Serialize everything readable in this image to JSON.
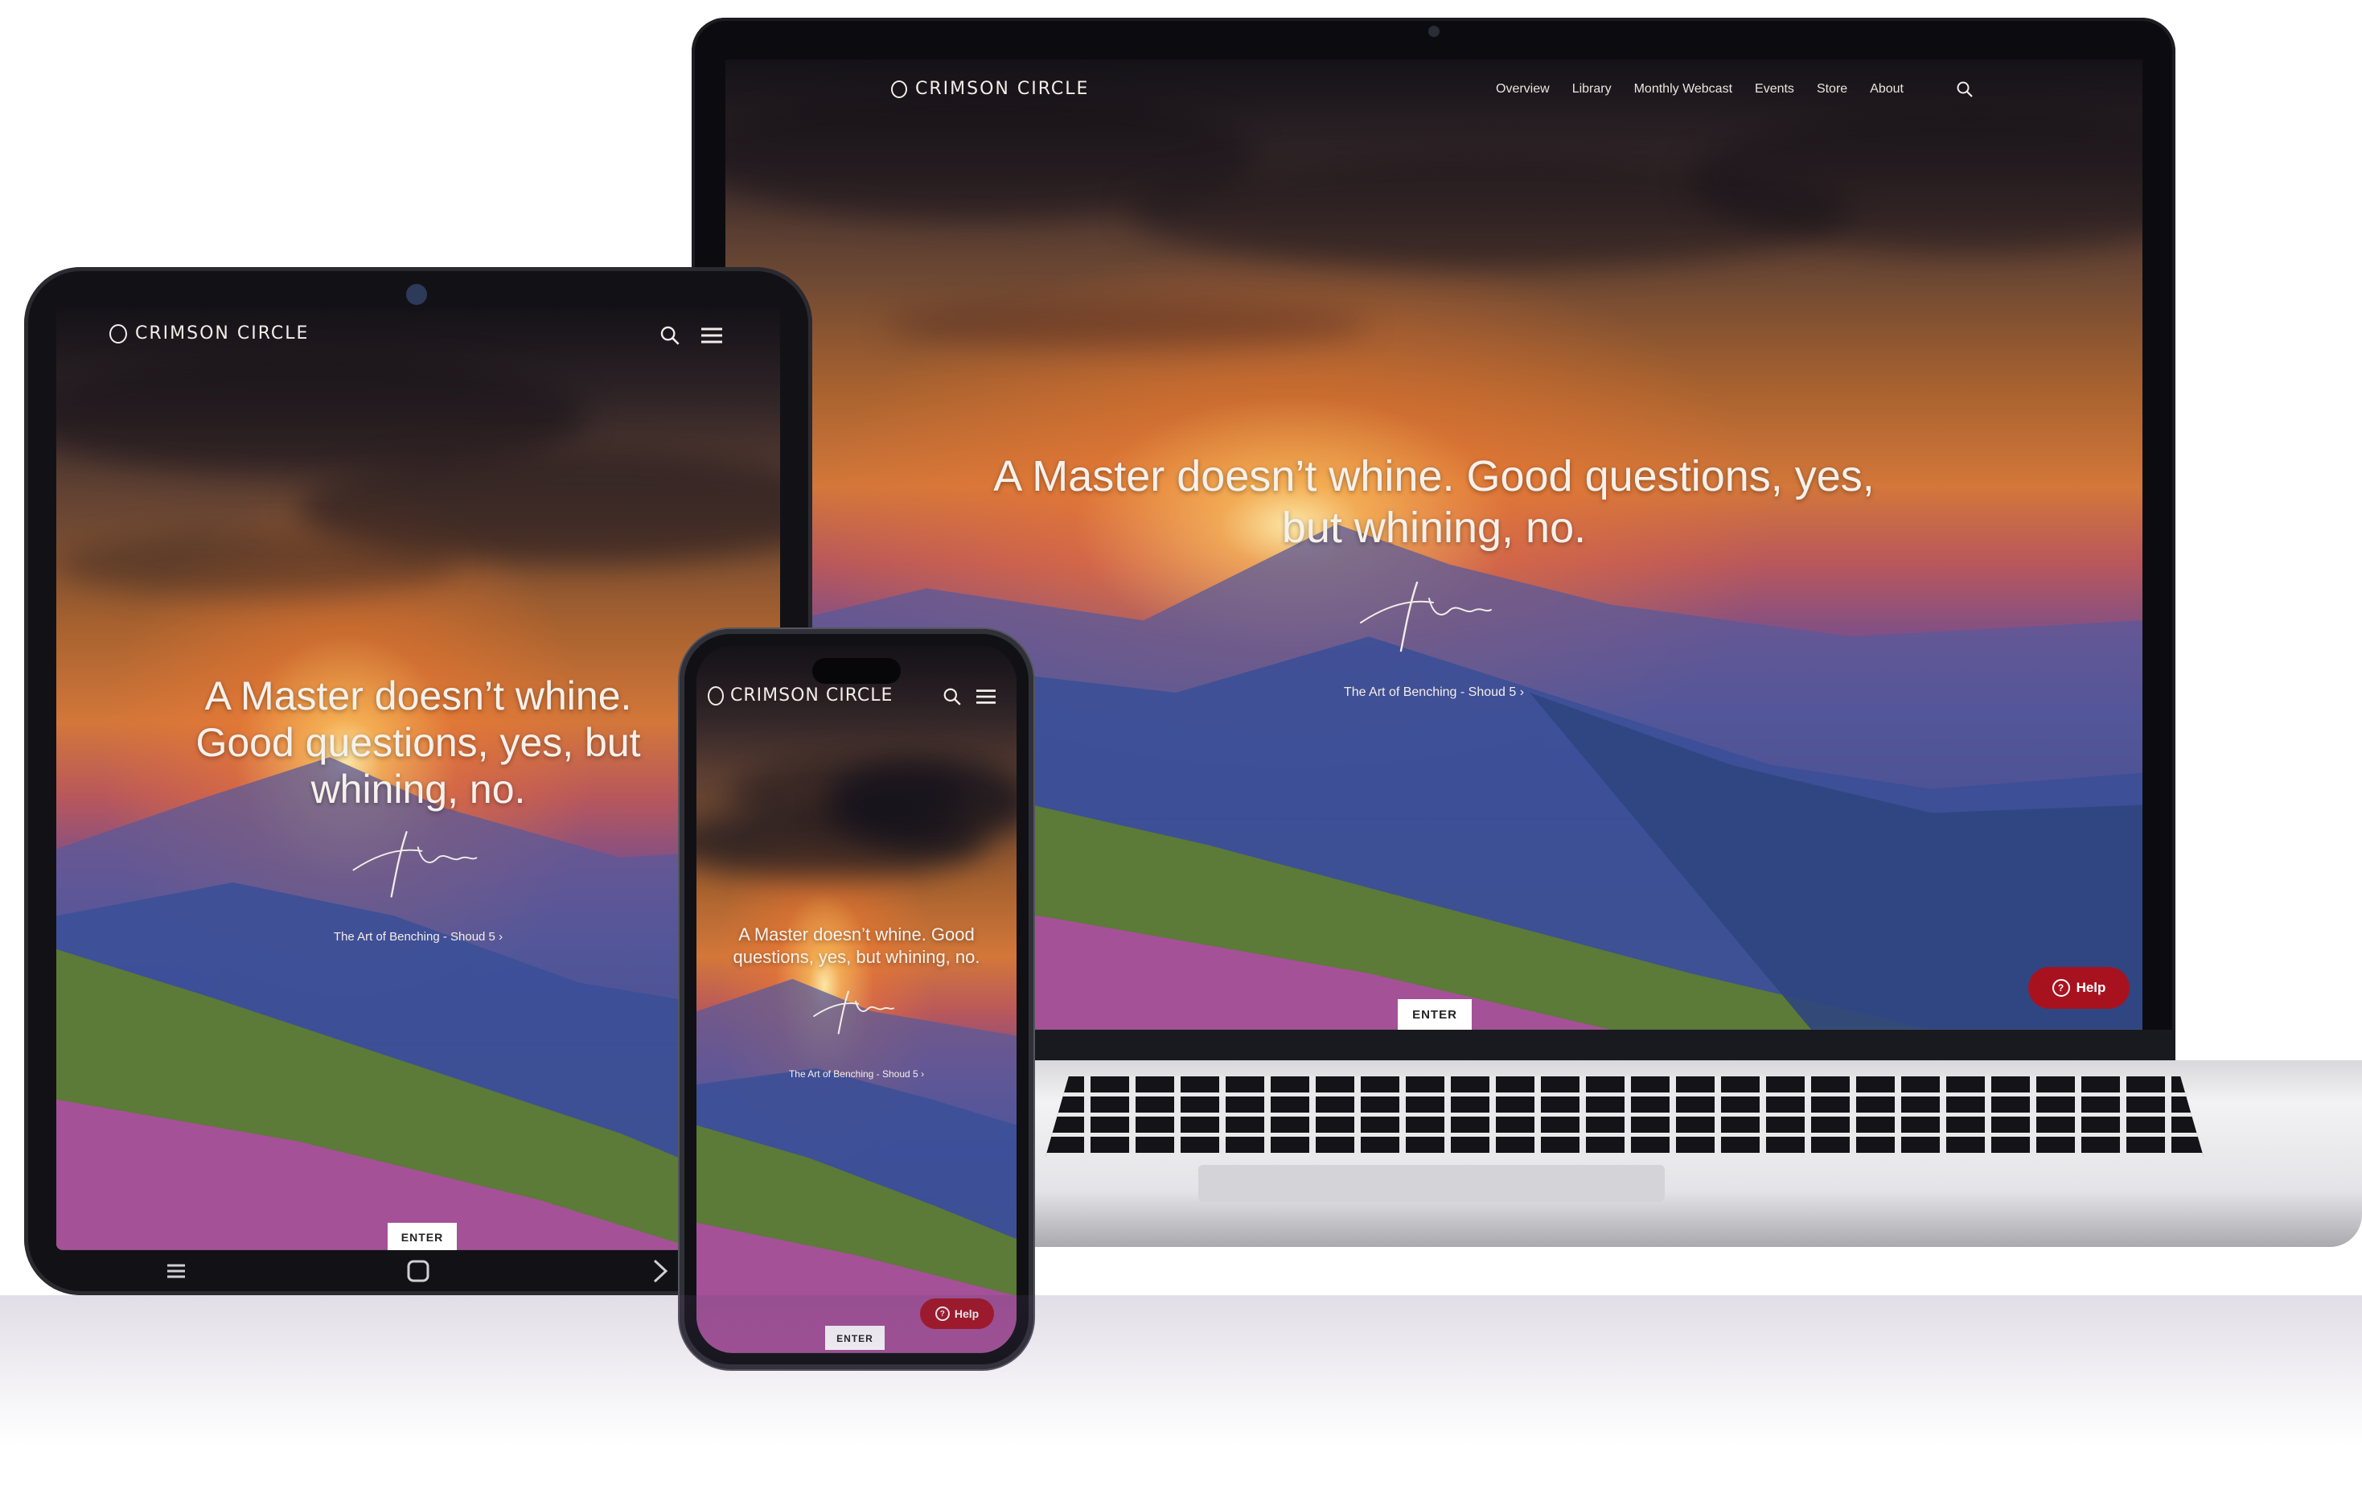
{
  "brand": {
    "name": "CRIMSON CIRCLE"
  },
  "nav": {
    "items": [
      "Overview",
      "Library",
      "Monthly Webcast",
      "Events",
      "Store",
      "About"
    ]
  },
  "hero": {
    "quote_laptop_line1": "A Master doesn’t whine. Good questions, yes,",
    "quote_laptop_line2": "but whining, no.",
    "quote_tablet_line1": "A Master doesn’t whine.",
    "quote_tablet_line2": "Good questions, yes, but",
    "quote_tablet_line3": "whining, no.",
    "quote_phone_line1": "A Master doesn’t whine. Good",
    "quote_phone_line2": "questions, yes, but whining, no.",
    "source": "The Art of Benching - Shoud 5",
    "source_chevron": "›"
  },
  "buttons": {
    "enter": "ENTER",
    "help": "Help"
  },
  "icons": {
    "search": "search-icon",
    "menu": "hamburger-menu-icon",
    "help": "question-circle-icon",
    "chevron": "chevron-right-icon"
  },
  "colors": {
    "help_button": "#a8121f",
    "text": "#f6f1ec"
  }
}
